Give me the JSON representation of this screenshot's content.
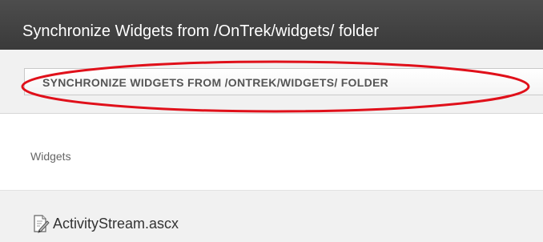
{
  "window": {
    "title": "Synchronize Widgets from /OnTrek/widgets/ folder"
  },
  "toolbar": {
    "sync_button_label": "SYNCHRONIZE WIDGETS FROM /ONTREK/WIDGETS/ FOLDER"
  },
  "section": {
    "label": "Widgets"
  },
  "files": [
    {
      "name": "ActivityStream.ascx",
      "icon": "edit-document-icon"
    }
  ],
  "colors": {
    "title_bar": "#3f3f3f",
    "annotation": "#e0101a"
  }
}
